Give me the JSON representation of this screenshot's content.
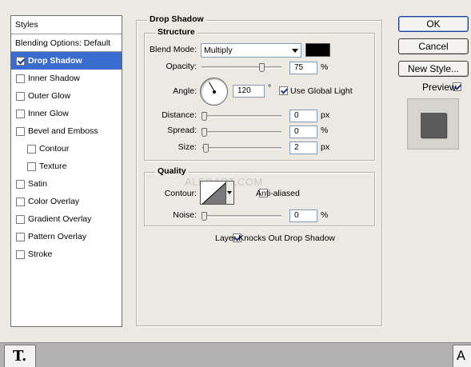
{
  "styles": {
    "header": "Styles",
    "blending": "Blending Options: Default",
    "items": [
      {
        "label": "Drop Shadow",
        "checked": true,
        "active": true,
        "sub": false
      },
      {
        "label": "Inner Shadow",
        "checked": false,
        "active": false,
        "sub": false
      },
      {
        "label": "Outer Glow",
        "checked": false,
        "active": false,
        "sub": false
      },
      {
        "label": "Inner Glow",
        "checked": false,
        "active": false,
        "sub": false
      },
      {
        "label": "Bevel and Emboss",
        "checked": false,
        "active": false,
        "sub": false
      },
      {
        "label": "Contour",
        "checked": false,
        "active": false,
        "sub": true
      },
      {
        "label": "Texture",
        "checked": false,
        "active": false,
        "sub": true
      },
      {
        "label": "Satin",
        "checked": false,
        "active": false,
        "sub": false
      },
      {
        "label": "Color Overlay",
        "checked": false,
        "active": false,
        "sub": false
      },
      {
        "label": "Gradient Overlay",
        "checked": false,
        "active": false,
        "sub": false
      },
      {
        "label": "Pattern Overlay",
        "checked": false,
        "active": false,
        "sub": false
      },
      {
        "label": "Stroke",
        "checked": false,
        "active": false,
        "sub": false
      }
    ]
  },
  "drop_shadow": {
    "title": "Drop Shadow",
    "structure": {
      "title": "Structure",
      "blend_mode_label": "Blend Mode:",
      "blend_mode_value": "Multiply",
      "shadow_color": "#000000",
      "opacity_label": "Opacity:",
      "opacity_value": "75",
      "opacity_unit": "%",
      "opacity_fraction": 0.75,
      "angle_label": "Angle:",
      "angle_value": "120",
      "angle_unit": "°",
      "use_global_light_label": "Use Global Light",
      "use_global_light": true,
      "distance_label": "Distance:",
      "distance_value": "0",
      "distance_unit": "px",
      "spread_label": "Spread:",
      "spread_value": "0",
      "spread_unit": "%",
      "size_label": "Size:",
      "size_value": "2",
      "size_unit": "px"
    },
    "quality": {
      "title": "Quality",
      "contour_label": "Contour:",
      "anti_aliased_label": "Anti-aliased",
      "anti_aliased": false,
      "noise_label": "Noise:",
      "noise_value": "0",
      "noise_unit": "%"
    },
    "knockout_label": "Layer Knocks Out Drop Shadow",
    "knockout": true
  },
  "buttons": {
    "ok": "OK",
    "cancel": "Cancel",
    "new_style": "New Style..."
  },
  "preview": {
    "label": "Preview",
    "checked": true
  },
  "watermark": "ALFOART.COM",
  "toolbar": {
    "text_tool_glyph": "T.",
    "character_glyph": "A"
  }
}
